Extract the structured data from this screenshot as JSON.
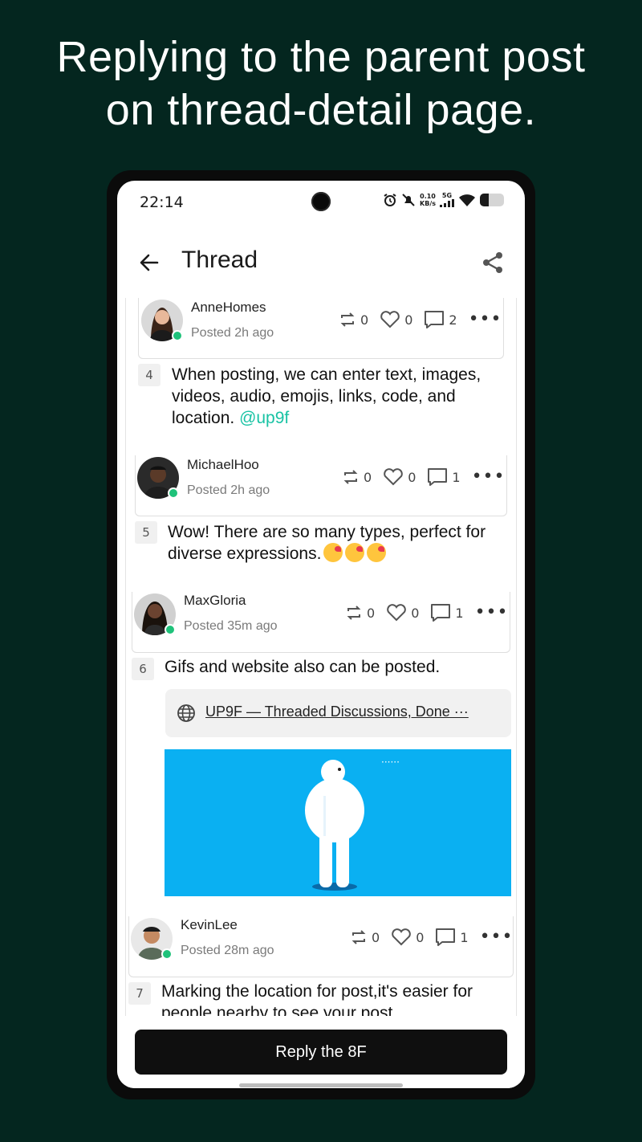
{
  "headline": {
    "line1": "Replying to the parent post",
    "line2": "on thread-detail page."
  },
  "status_bar": {
    "time": "22:14",
    "net_speed_value": "0.10",
    "net_speed_unit": "KB/s",
    "network": "5G",
    "battery_level": 0.35
  },
  "app_bar": {
    "title": "Thread"
  },
  "posts": [
    {
      "username": "AnneHomes",
      "posted": "Posted 2h ago",
      "reposts": "0",
      "likes": "0",
      "comments": "2",
      "floor": "4",
      "text": "When posting, we can enter text, images, videos, audio, emojis, links, code, and location.",
      "mention": "@up9f"
    },
    {
      "username": "MichaelHoo",
      "posted": "Posted 2h ago",
      "reposts": "0",
      "likes": "0",
      "comments": "1",
      "floor": "5",
      "text": "Wow!  There are so many types, perfect for diverse expressions."
    },
    {
      "username": "MaxGloria",
      "posted": "Posted 35m ago",
      "reposts": "0",
      "likes": "0",
      "comments": "1",
      "floor": "6",
      "text": "Gifs and website also can be posted.",
      "link": "UP9F — Threaded Discussions, Done ···"
    },
    {
      "username": "KevinLee",
      "posted": "Posted 28m ago",
      "reposts": "0",
      "likes": "0",
      "comments": "1",
      "floor": "7",
      "text": "Marking the location for post,it's easier for people nearby to see your post."
    }
  ],
  "reply_button": {
    "label": "Reply the 8F"
  },
  "colors": {
    "background": "#04261f",
    "mention": "#19c3a4",
    "online": "#1fc27a",
    "gif_bg": "#0ab0f2"
  },
  "icons": [
    "back-arrow-icon",
    "share-icon",
    "repost-icon",
    "heart-icon",
    "comment-icon",
    "more-icon",
    "globe-icon"
  ]
}
